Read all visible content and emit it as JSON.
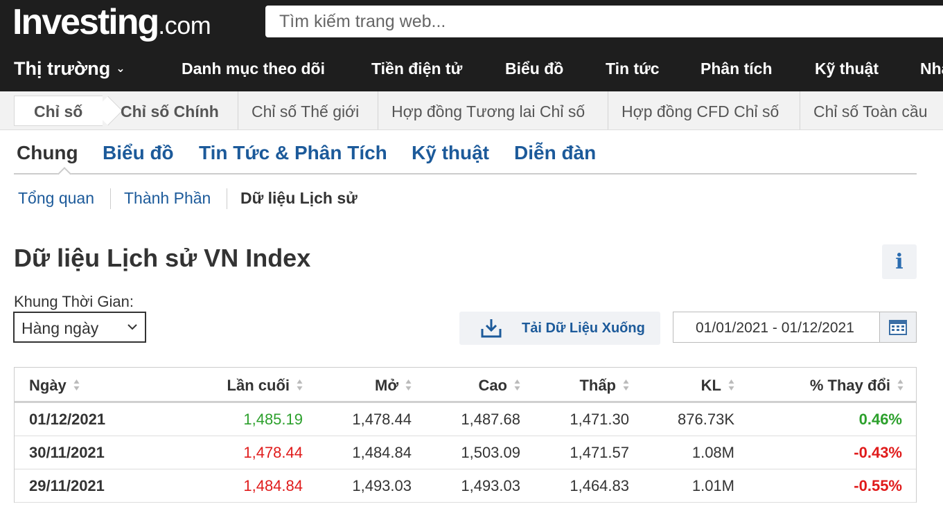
{
  "logo": {
    "brand": "Investing",
    "suffix": ".com"
  },
  "search": {
    "placeholder": "Tìm kiếm trang web..."
  },
  "main_nav": {
    "items": [
      "Thị trường",
      "Danh mục theo dõi",
      "Tiền điện tử",
      "Biểu đồ",
      "Tin tức",
      "Phân tích",
      "Kỹ thuật",
      "Nha"
    ]
  },
  "sub_nav": {
    "crumb": "Chỉ số",
    "items": [
      "Chỉ số Chính",
      "Chỉ số Thế giới",
      "Hợp đồng Tương lai Chỉ số",
      "Hợp đồng CFD Chỉ số",
      "Chỉ số Toàn cầu"
    ]
  },
  "tabs": [
    "Chung",
    "Biểu đồ",
    "Tin Tức & Phân Tích",
    "Kỹ thuật",
    "Diễn đàn"
  ],
  "sub_tabs": [
    "Tổng quan",
    "Thành Phần",
    "Dữ liệu Lịch sử"
  ],
  "page_title": "Dữ liệu Lịch sử VN Index",
  "info_icon_text": "i",
  "timeframe": {
    "label": "Khung Thời Gian:",
    "selected": "Hàng ngày"
  },
  "download": {
    "label": "Tải Dữ Liệu Xuống"
  },
  "date_range": {
    "value": "01/01/2021 - 01/12/2021"
  },
  "table": {
    "headers": [
      "Ngày",
      "Lần cuối",
      "Mở",
      "Cao",
      "Thấp",
      "KL",
      "% Thay đổi"
    ],
    "rows": [
      [
        "01/12/2021",
        "1,485.19",
        "1,478.44",
        "1,487.68",
        "1,471.30",
        "876.73K",
        "0.46%"
      ],
      [
        "30/11/2021",
        "1,478.44",
        "1,484.84",
        "1,503.09",
        "1,471.57",
        "1.08M",
        "-0.43%"
      ],
      [
        "29/11/2021",
        "1,484.84",
        "1,493.03",
        "1,493.03",
        "1,464.83",
        "1.01M",
        "-0.55%"
      ]
    ]
  },
  "colors": {
    "positive": "#2ca02c",
    "negative": "#e01b1b",
    "link": "#1c5a9a",
    "dark_bar": "#1e1e1e"
  },
  "icons": [
    "caret-down-icon",
    "info-icon",
    "chevron-down-icon",
    "download-icon",
    "calendar-icon",
    "sort-icon"
  ]
}
